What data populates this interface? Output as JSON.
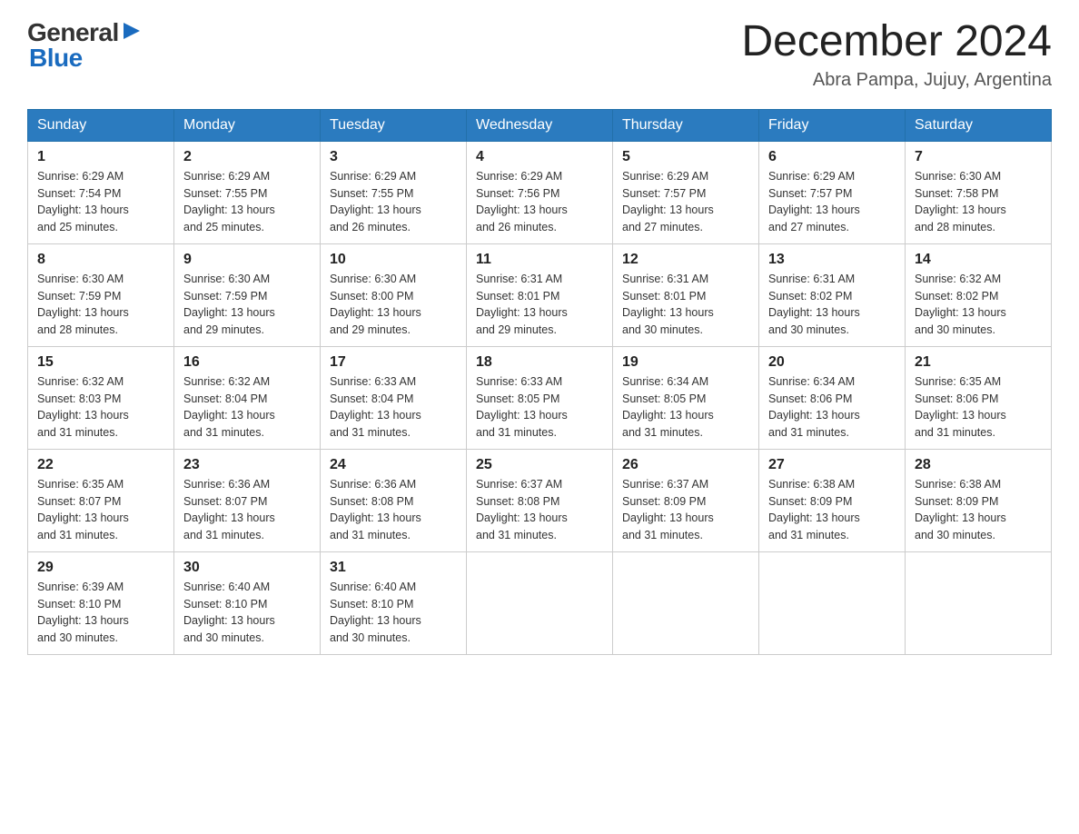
{
  "header": {
    "logo_general": "General",
    "logo_blue": "Blue",
    "title": "December 2024",
    "subtitle": "Abra Pampa, Jujuy, Argentina"
  },
  "days_of_week": [
    "Sunday",
    "Monday",
    "Tuesday",
    "Wednesday",
    "Thursday",
    "Friday",
    "Saturday"
  ],
  "weeks": [
    [
      {
        "day": "1",
        "info": "Sunrise: 6:29 AM\nSunset: 7:54 PM\nDaylight: 13 hours\nand 25 minutes."
      },
      {
        "day": "2",
        "info": "Sunrise: 6:29 AM\nSunset: 7:55 PM\nDaylight: 13 hours\nand 25 minutes."
      },
      {
        "day": "3",
        "info": "Sunrise: 6:29 AM\nSunset: 7:55 PM\nDaylight: 13 hours\nand 26 minutes."
      },
      {
        "day": "4",
        "info": "Sunrise: 6:29 AM\nSunset: 7:56 PM\nDaylight: 13 hours\nand 26 minutes."
      },
      {
        "day": "5",
        "info": "Sunrise: 6:29 AM\nSunset: 7:57 PM\nDaylight: 13 hours\nand 27 minutes."
      },
      {
        "day": "6",
        "info": "Sunrise: 6:29 AM\nSunset: 7:57 PM\nDaylight: 13 hours\nand 27 minutes."
      },
      {
        "day": "7",
        "info": "Sunrise: 6:30 AM\nSunset: 7:58 PM\nDaylight: 13 hours\nand 28 minutes."
      }
    ],
    [
      {
        "day": "8",
        "info": "Sunrise: 6:30 AM\nSunset: 7:59 PM\nDaylight: 13 hours\nand 28 minutes."
      },
      {
        "day": "9",
        "info": "Sunrise: 6:30 AM\nSunset: 7:59 PM\nDaylight: 13 hours\nand 29 minutes."
      },
      {
        "day": "10",
        "info": "Sunrise: 6:30 AM\nSunset: 8:00 PM\nDaylight: 13 hours\nand 29 minutes."
      },
      {
        "day": "11",
        "info": "Sunrise: 6:31 AM\nSunset: 8:01 PM\nDaylight: 13 hours\nand 29 minutes."
      },
      {
        "day": "12",
        "info": "Sunrise: 6:31 AM\nSunset: 8:01 PM\nDaylight: 13 hours\nand 30 minutes."
      },
      {
        "day": "13",
        "info": "Sunrise: 6:31 AM\nSunset: 8:02 PM\nDaylight: 13 hours\nand 30 minutes."
      },
      {
        "day": "14",
        "info": "Sunrise: 6:32 AM\nSunset: 8:02 PM\nDaylight: 13 hours\nand 30 minutes."
      }
    ],
    [
      {
        "day": "15",
        "info": "Sunrise: 6:32 AM\nSunset: 8:03 PM\nDaylight: 13 hours\nand 31 minutes."
      },
      {
        "day": "16",
        "info": "Sunrise: 6:32 AM\nSunset: 8:04 PM\nDaylight: 13 hours\nand 31 minutes."
      },
      {
        "day": "17",
        "info": "Sunrise: 6:33 AM\nSunset: 8:04 PM\nDaylight: 13 hours\nand 31 minutes."
      },
      {
        "day": "18",
        "info": "Sunrise: 6:33 AM\nSunset: 8:05 PM\nDaylight: 13 hours\nand 31 minutes."
      },
      {
        "day": "19",
        "info": "Sunrise: 6:34 AM\nSunset: 8:05 PM\nDaylight: 13 hours\nand 31 minutes."
      },
      {
        "day": "20",
        "info": "Sunrise: 6:34 AM\nSunset: 8:06 PM\nDaylight: 13 hours\nand 31 minutes."
      },
      {
        "day": "21",
        "info": "Sunrise: 6:35 AM\nSunset: 8:06 PM\nDaylight: 13 hours\nand 31 minutes."
      }
    ],
    [
      {
        "day": "22",
        "info": "Sunrise: 6:35 AM\nSunset: 8:07 PM\nDaylight: 13 hours\nand 31 minutes."
      },
      {
        "day": "23",
        "info": "Sunrise: 6:36 AM\nSunset: 8:07 PM\nDaylight: 13 hours\nand 31 minutes."
      },
      {
        "day": "24",
        "info": "Sunrise: 6:36 AM\nSunset: 8:08 PM\nDaylight: 13 hours\nand 31 minutes."
      },
      {
        "day": "25",
        "info": "Sunrise: 6:37 AM\nSunset: 8:08 PM\nDaylight: 13 hours\nand 31 minutes."
      },
      {
        "day": "26",
        "info": "Sunrise: 6:37 AM\nSunset: 8:09 PM\nDaylight: 13 hours\nand 31 minutes."
      },
      {
        "day": "27",
        "info": "Sunrise: 6:38 AM\nSunset: 8:09 PM\nDaylight: 13 hours\nand 31 minutes."
      },
      {
        "day": "28",
        "info": "Sunrise: 6:38 AM\nSunset: 8:09 PM\nDaylight: 13 hours\nand 30 minutes."
      }
    ],
    [
      {
        "day": "29",
        "info": "Sunrise: 6:39 AM\nSunset: 8:10 PM\nDaylight: 13 hours\nand 30 minutes."
      },
      {
        "day": "30",
        "info": "Sunrise: 6:40 AM\nSunset: 8:10 PM\nDaylight: 13 hours\nand 30 minutes."
      },
      {
        "day": "31",
        "info": "Sunrise: 6:40 AM\nSunset: 8:10 PM\nDaylight: 13 hours\nand 30 minutes."
      },
      {
        "day": "",
        "info": ""
      },
      {
        "day": "",
        "info": ""
      },
      {
        "day": "",
        "info": ""
      },
      {
        "day": "",
        "info": ""
      }
    ]
  ]
}
